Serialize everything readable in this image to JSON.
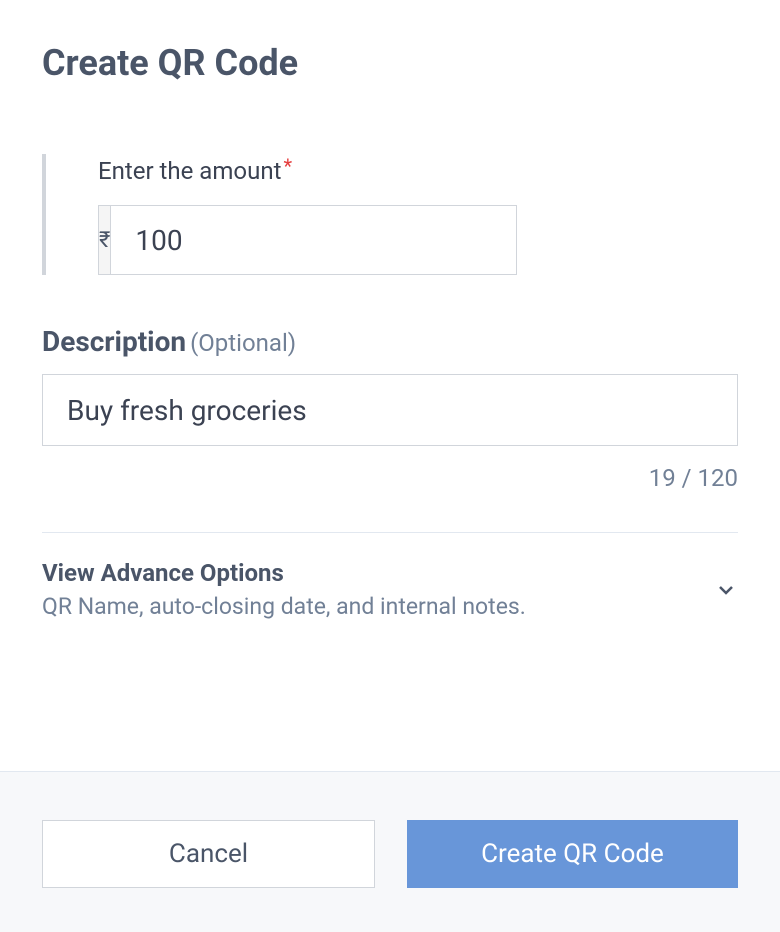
{
  "page": {
    "title": "Create QR Code"
  },
  "amount": {
    "label": "Enter the amount",
    "required_marker": "*",
    "currency_symbol": "₹",
    "value": "100"
  },
  "description": {
    "label": "Description",
    "optional_text": "(Optional)",
    "value": "Buy fresh groceries",
    "char_count": "19 / 120"
  },
  "advance_options": {
    "title": "View Advance Options",
    "subtitle": "QR Name, auto-closing date, and internal notes."
  },
  "footer": {
    "cancel_label": "Cancel",
    "create_label": "Create QR Code"
  }
}
